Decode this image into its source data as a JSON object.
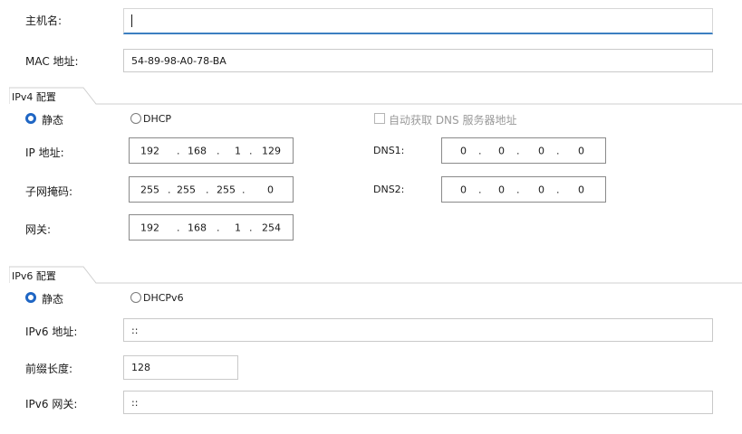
{
  "hostname": {
    "label": "主机名:",
    "value": ""
  },
  "mac": {
    "label": "MAC 地址:",
    "value": "54-89-98-A0-78-BA"
  },
  "ipv4": {
    "section_title": "IPv4 配置",
    "static_label": "静态",
    "dhcp_label": "DHCP",
    "auto_dns_label": "自动获取 DNS 服务器地址",
    "static_selected": true,
    "auto_dns_checked": false,
    "ip": {
      "label": "IP 地址:",
      "octets": [
        "192",
        "168",
        "1",
        "129"
      ]
    },
    "mask": {
      "label": "子网掩码:",
      "octets": [
        "255",
        "255",
        "255",
        "0"
      ]
    },
    "gateway": {
      "label": "网关:",
      "octets": [
        "192",
        "168",
        "1",
        "254"
      ]
    },
    "dns1": {
      "label": "DNS1:",
      "octets": [
        "0",
        "0",
        "0",
        "0"
      ]
    },
    "dns2": {
      "label": "DNS2:",
      "octets": [
        "0",
        "0",
        "0",
        "0"
      ]
    }
  },
  "ipv6": {
    "section_title": "IPv6 配置",
    "static_label": "静态",
    "dhcp_label": "DHCPv6",
    "static_selected": true,
    "address": {
      "label": "IPv6 地址:",
      "value": "::"
    },
    "prefix": {
      "label": "前缀长度:",
      "value": "128"
    },
    "gateway": {
      "label": "IPv6 网关:",
      "value": "::"
    }
  },
  "colors": {
    "accent": "#1f66c4",
    "focus_underline": "#3c7fc1"
  }
}
